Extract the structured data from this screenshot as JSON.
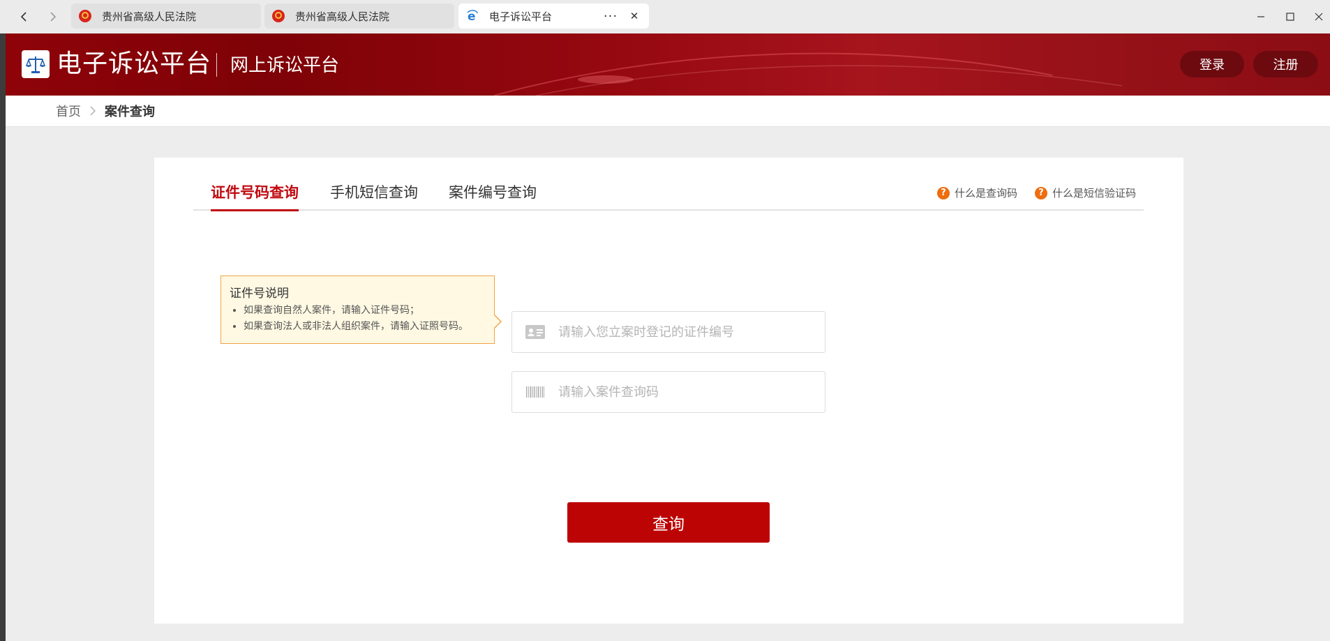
{
  "browser": {
    "tabs": [
      {
        "title": "贵州省高级人民法院",
        "active": false
      },
      {
        "title": "贵州省高级人民法院",
        "active": false
      },
      {
        "title": "电子诉讼平台",
        "active": true
      }
    ],
    "more_glyph": "···",
    "close_glyph": "✕"
  },
  "header": {
    "site_name": "电子诉讼平台",
    "sub_name": "网上诉讼平台",
    "login_label": "登录",
    "register_label": "注册"
  },
  "breadcrumb": {
    "home": "首页",
    "current": "案件查询"
  },
  "query_tabs": [
    {
      "label": "证件号码查询",
      "active": true
    },
    {
      "label": "手机短信查询",
      "active": false
    },
    {
      "label": "案件编号查询",
      "active": false
    }
  ],
  "help_links": [
    {
      "label": "什么是查询码"
    },
    {
      "label": "什么是短信验证码"
    }
  ],
  "tooltip": {
    "title": "证件号说明",
    "items": [
      "如果查询自然人案件，请输入证件号码；",
      "如果查询法人或非法人组织案件，请输入证照号码。"
    ]
  },
  "form": {
    "id_placeholder": "请输入您立案时登记的证件编号",
    "id_value": "",
    "code_placeholder": "请输入案件查询码",
    "code_value": "",
    "submit_label": "查询"
  },
  "colors": {
    "brand_red": "#bd0405",
    "active_tab": "#c00a10",
    "help_icon": "#ee6d0e",
    "tooltip_border": "#f1a345",
    "tooltip_bg": "#fff9e3"
  }
}
